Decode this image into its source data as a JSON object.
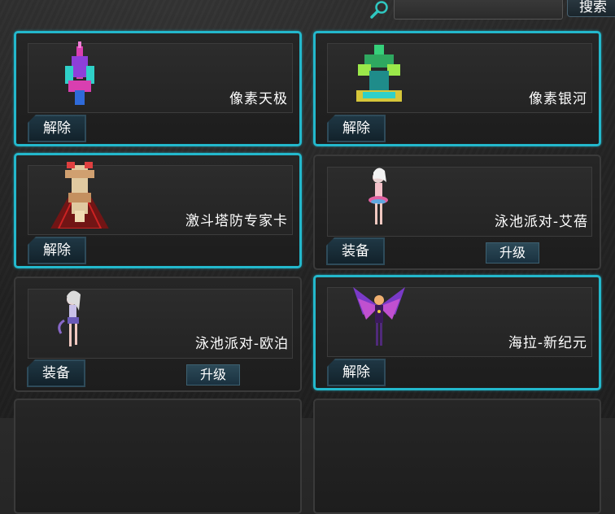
{
  "search": {
    "button_label": "搜索",
    "value": ""
  },
  "cards": [
    {
      "name": "像素天极",
      "action": "解除",
      "selected": true,
      "upgrade": "",
      "icon": "pixel-ship-pink-icon"
    },
    {
      "name": "像素银河",
      "action": "解除",
      "selected": true,
      "upgrade": "",
      "icon": "pixel-ship-green-icon"
    },
    {
      "name": "激斗塔防专家卡",
      "action": "解除",
      "selected": true,
      "upgrade": "",
      "icon": "tower-defense-expert-icon"
    },
    {
      "name": "泳池派对-艾蓓",
      "action": "装备",
      "selected": false,
      "upgrade": "升级",
      "icon": "pool-party-girl-icon"
    },
    {
      "name": "泳池派对-欧泊",
      "action": "装备",
      "selected": false,
      "upgrade": "升级",
      "icon": "pool-party-girl-2-icon"
    },
    {
      "name": "海拉-新纪元",
      "action": "解除",
      "selected": true,
      "upgrade": "",
      "icon": "hela-new-era-icon"
    }
  ],
  "colors": {
    "selected_border": "#23b8cc",
    "card_bg": "#222222",
    "button_bg": "#1a2f3a"
  }
}
